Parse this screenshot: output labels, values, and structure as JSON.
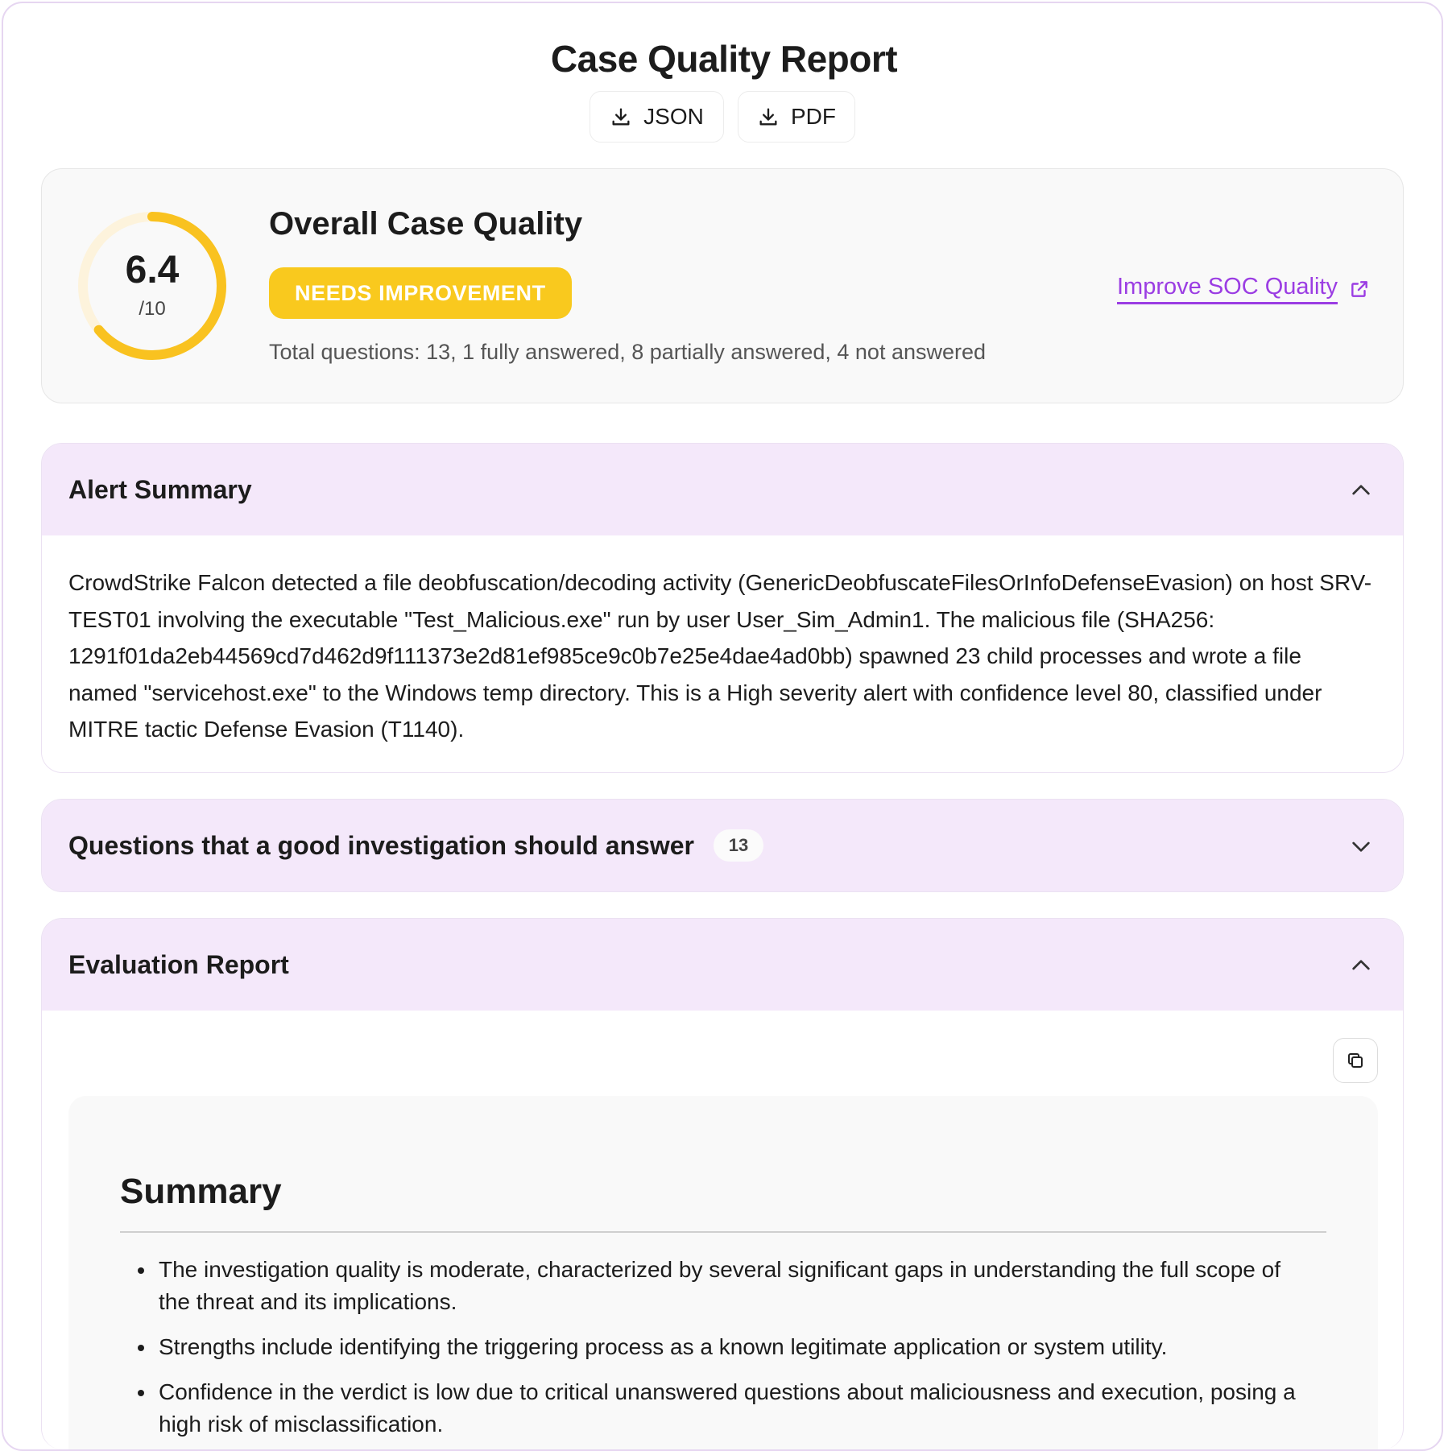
{
  "page": {
    "title": "Case Quality Report"
  },
  "downloads": {
    "json_label": "JSON",
    "pdf_label": "PDF"
  },
  "overall": {
    "title": "Overall Case Quality",
    "score": "6.4",
    "max": "/10",
    "score_fraction": 0.64,
    "badge": "NEEDS IMPROVEMENT",
    "badge_color": "#f9c91e",
    "totals": "Total questions: 13, 1 fully answered, 8 partially answered, 4 not answered",
    "improve_link": "Improve SOC Quality",
    "link_color": "#9b3de3"
  },
  "alert_summary": {
    "title": "Alert Summary",
    "expanded": true,
    "body": "CrowdStrike Falcon detected a file deobfuscation/decoding activity (GenericDeobfuscateFilesOrInfoDefenseEvasion) on host SRV-TEST01 involving the executable \"Test_Malicious.exe\" run by user User_Sim_Admin1. The malicious file (SHA256: 1291f01da2eb44569cd7d462d9f111373e2d81ef985ce9c0b7e25e4dae4ad0bb) spawned 23 child processes and wrote a file named \"servicehost.exe\" to the Windows temp directory. This is a High severity alert with confidence level 80, classified under MITRE tactic Defense Evasion (T1140)."
  },
  "questions": {
    "title": "Questions that a good investigation should answer",
    "count": "13",
    "expanded": false
  },
  "evaluation": {
    "title": "Evaluation Report",
    "expanded": true,
    "summary_heading": "Summary",
    "bullets": [
      "The investigation quality is moderate, characterized by several significant gaps in understanding the full scope of the threat and its implications.",
      "Strengths include identifying the triggering process as a known legitimate application or system utility.",
      "Confidence in the verdict is low due to critical unanswered questions about maliciousness and execution, posing a high risk of misclassification."
    ]
  },
  "icons": {
    "download": "download-icon",
    "external": "external-link-icon",
    "chevron_up": "chevron-up-icon",
    "chevron_down": "chevron-down-icon",
    "copy": "copy-icon"
  }
}
